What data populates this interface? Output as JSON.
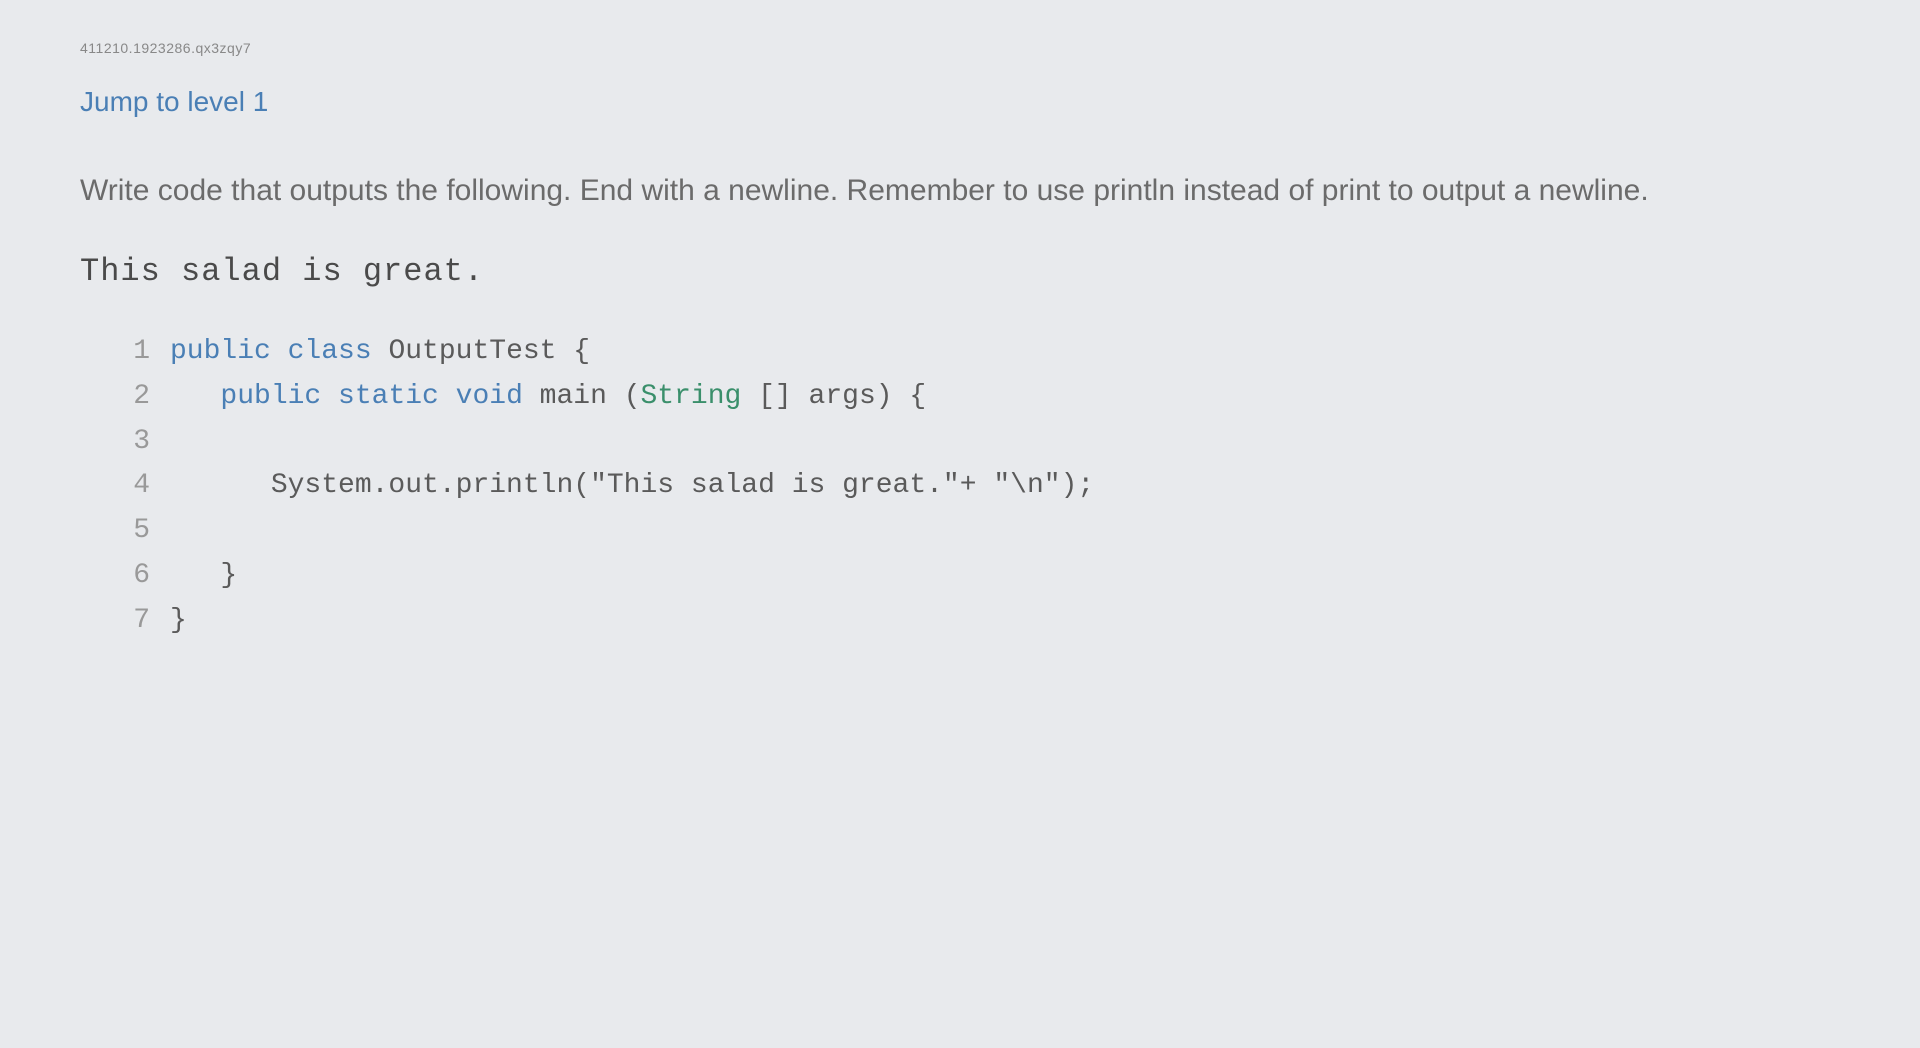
{
  "header": {
    "id_text": "411210.1923286.qx3zqy7"
  },
  "level": {
    "link_text": "Jump to level 1"
  },
  "problem": {
    "instructions": "Write code that outputs the following. End with a newline. Remember to use println instead of print to output a newline.",
    "expected_output": "This salad is great."
  },
  "code": {
    "lines": [
      {
        "num": "1",
        "segments": [
          {
            "cls": "keyword",
            "text": "public class"
          },
          {
            "cls": "plain",
            "text": " OutputTest {"
          }
        ]
      },
      {
        "num": "2",
        "segments": [
          {
            "cls": "plain",
            "text": "   "
          },
          {
            "cls": "keyword",
            "text": "public static void"
          },
          {
            "cls": "plain",
            "text": " main ("
          },
          {
            "cls": "type",
            "text": "String"
          },
          {
            "cls": "plain",
            "text": " [] args) {"
          }
        ]
      },
      {
        "num": "3",
        "segments": [
          {
            "cls": "plain",
            "text": ""
          }
        ]
      },
      {
        "num": "4",
        "segments": [
          {
            "cls": "plain",
            "text": "      System.out.println("
          },
          {
            "cls": "string",
            "text": "\"This salad is great.\""
          },
          {
            "cls": "plain",
            "text": "+ "
          },
          {
            "cls": "string",
            "text": "\"\\n\""
          },
          {
            "cls": "plain",
            "text": ");"
          }
        ]
      },
      {
        "num": "5",
        "segments": [
          {
            "cls": "plain",
            "text": ""
          }
        ]
      },
      {
        "num": "6",
        "segments": [
          {
            "cls": "plain",
            "text": "   }"
          }
        ]
      },
      {
        "num": "7",
        "segments": [
          {
            "cls": "plain",
            "text": "}"
          }
        ]
      }
    ]
  }
}
